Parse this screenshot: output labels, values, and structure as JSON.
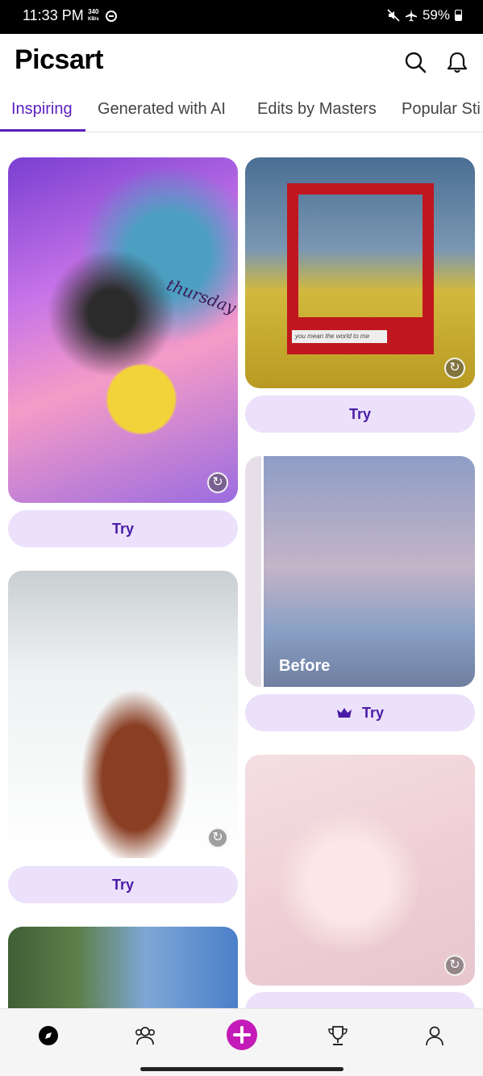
{
  "status_bar": {
    "time": "11:33 PM",
    "speed_value": "340",
    "speed_unit": "KB/s",
    "battery": "59%"
  },
  "header": {
    "logo": "Picsart"
  },
  "tabs": [
    {
      "label": "Inspiring"
    },
    {
      "label": "Generated with AI"
    },
    {
      "label": "Edits by Masters"
    },
    {
      "label": "Popular Sti"
    }
  ],
  "feed": {
    "try_label": "Try",
    "card1_overlay_text": "thursday",
    "card2_note_text": "you mean the world to me",
    "card3_before_label": "Before"
  },
  "colors": {
    "accent": "#5a1fbf",
    "try_button_bg": "#ebe1fb",
    "add_button": "#c41bb8"
  },
  "icons": {
    "search": "search-icon",
    "notifications": "bell-icon",
    "replay": "replay-icon",
    "premium": "crown-icon",
    "discover": "compass-icon",
    "community": "people-icon",
    "create": "plus-icon",
    "challenges": "trophy-icon",
    "profile": "person-icon"
  }
}
